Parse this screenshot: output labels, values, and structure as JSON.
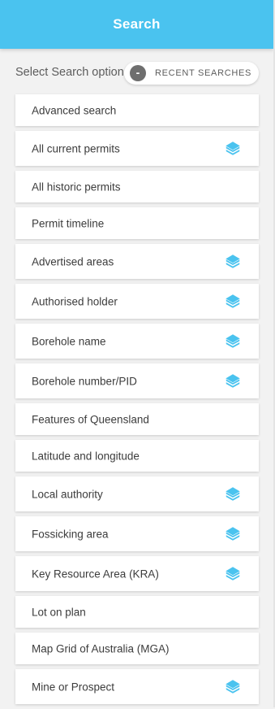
{
  "header": {
    "title": "Search"
  },
  "search_option": {
    "label": "Select Search option",
    "recent_toggle": "-",
    "recent_label": "RECENT SEARCHES"
  },
  "colors": {
    "accent": "#4ac3ef",
    "layer_icon": "#4ac3ef"
  },
  "items": [
    {
      "label": "Advanced search",
      "layer_icon": false
    },
    {
      "label": "All current permits",
      "layer_icon": true
    },
    {
      "label": "All historic permits",
      "layer_icon": false
    },
    {
      "label": "Permit timeline",
      "layer_icon": false
    },
    {
      "label": "Advertised areas",
      "layer_icon": true
    },
    {
      "label": "Authorised holder",
      "layer_icon": true
    },
    {
      "label": "Borehole name",
      "layer_icon": true
    },
    {
      "label": "Borehole number/PID",
      "layer_icon": true
    },
    {
      "label": "Features of Queensland",
      "layer_icon": false
    },
    {
      "label": "Latitude and longitude",
      "layer_icon": false
    },
    {
      "label": "Local authority",
      "layer_icon": true
    },
    {
      "label": "Fossicking area",
      "layer_icon": true
    },
    {
      "label": "Key Resource Area (KRA)",
      "layer_icon": true
    },
    {
      "label": "Lot on plan",
      "layer_icon": false
    },
    {
      "label": "Map Grid of Australia (MGA)",
      "layer_icon": false
    },
    {
      "label": "Mine or Prospect",
      "layer_icon": true
    }
  ]
}
